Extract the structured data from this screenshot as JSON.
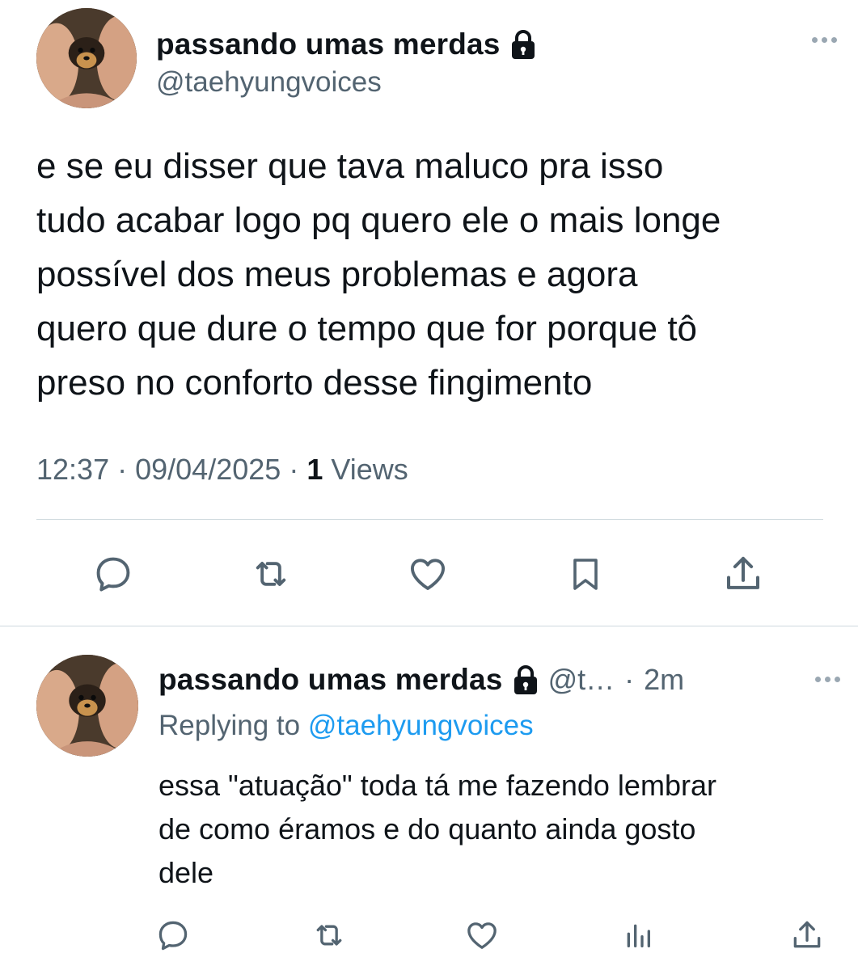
{
  "tweet": {
    "author_name": "passando umas merdas",
    "handle": "@taehyungvoices",
    "text": "e se eu disser que tava maluco pra isso\ntudo acabar logo pq quero ele o mais longe\npossível dos meus problemas e agora\nquero que dure o tempo que for porque tô\npreso no conforto desse fingimento",
    "time": "12:37",
    "date": "09/04/2025",
    "views_count": "1",
    "views_label": "Views",
    "actions": [
      "reply-icon",
      "retweet-icon",
      "like-icon",
      "bookmark-icon",
      "share-icon"
    ]
  },
  "reply": {
    "author_name": "passando umas merdas",
    "handle_truncated": "@t…",
    "age": "2m",
    "replying_prefix": "Replying to",
    "replying_to": "@taehyungvoices",
    "text": "essa \"atuação\" toda tá me fazendo lembrar\nde como éramos e do quanto ainda gosto\ndele",
    "actions": [
      "reply-icon",
      "retweet-icon",
      "like-icon",
      "views-icon",
      "share-icon"
    ]
  },
  "colors": {
    "text": "#0f1419",
    "secondary": "#536471",
    "accent": "#1d9bf0",
    "divider": "#cfd9de"
  }
}
